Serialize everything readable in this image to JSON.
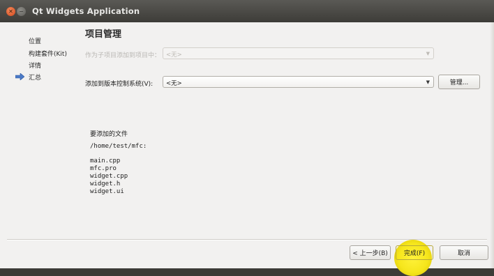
{
  "window": {
    "title": "Qt Widgets Application"
  },
  "sidebar": {
    "steps": [
      {
        "label": "位置"
      },
      {
        "label": "构建套件(Kit)"
      },
      {
        "label": "详情"
      },
      {
        "label": "汇总",
        "current": true
      }
    ]
  },
  "page": {
    "heading": "项目管理"
  },
  "subproject": {
    "label": "作为子项目添加到项目中：",
    "value": "<无>",
    "enabled": false
  },
  "vcs": {
    "label": "添加到版本控制系统(V):",
    "value": "<无>",
    "manage_label": "管理..."
  },
  "files": {
    "title": "要添加的文件",
    "path": "/home/test/mfc:",
    "list": [
      "main.cpp",
      "mfc.pro",
      "widget.cpp",
      "widget.h",
      "widget.ui"
    ]
  },
  "footer": {
    "back_label": "< 上一步(B)",
    "finish_label": "完成(F)",
    "cancel_label": "取消"
  },
  "colors": {
    "highlight": "#f6e61c",
    "close_button": "#e0552a",
    "current_step_arrow": "#4a79c6"
  }
}
